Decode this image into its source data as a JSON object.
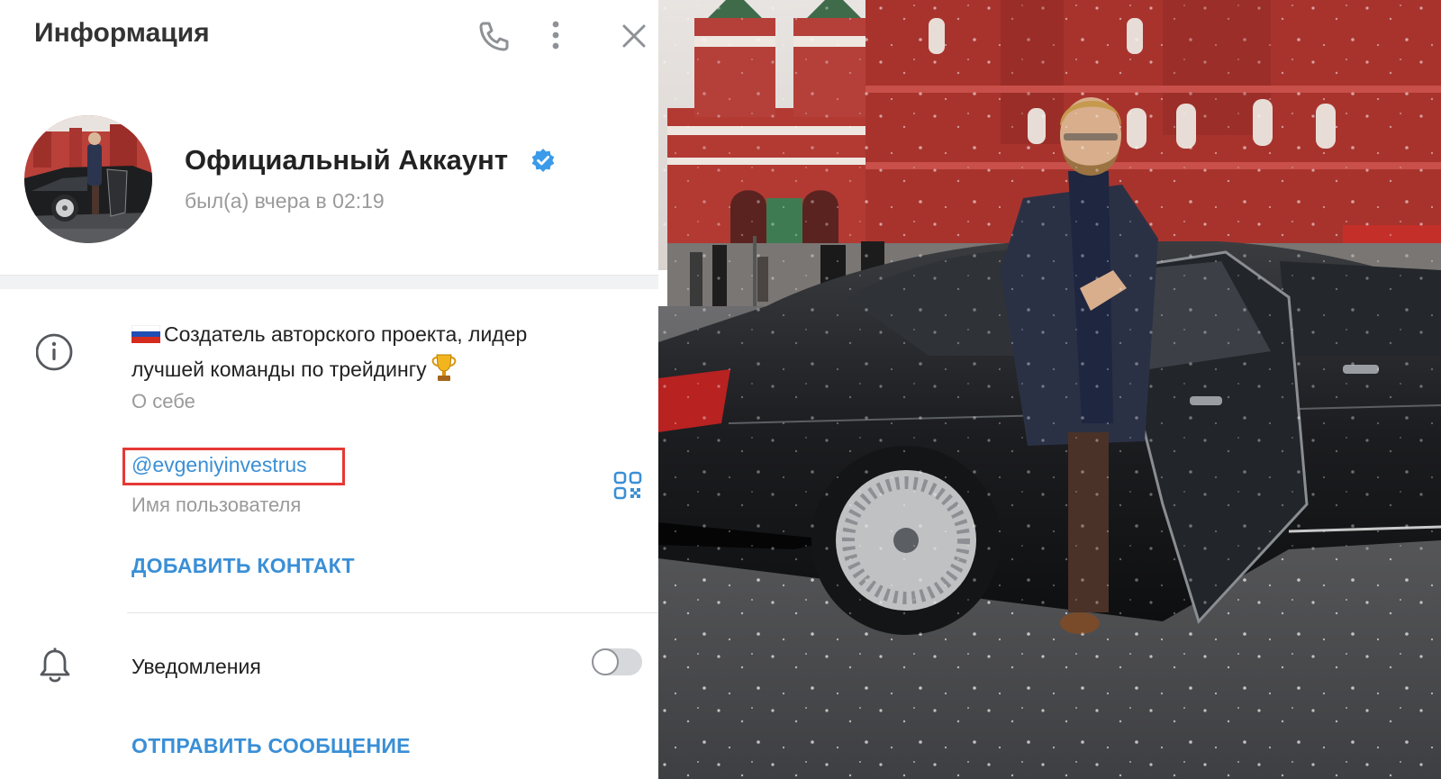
{
  "header": {
    "title": "Информация",
    "call_icon": "phone-icon",
    "more_icon": "more-vertical-icon",
    "close_icon": "close-icon"
  },
  "profile": {
    "name": "Официальный Аккаунт",
    "verified_icon": "verified-badge-icon",
    "status": "был(а) вчера в 02:19"
  },
  "bio": {
    "line1": "Создатель авторского проекта, лидер",
    "line2": "лучшей команды по трейдингу",
    "label": "О себе",
    "icon": "info-icon"
  },
  "username": {
    "value": "@evgeniyinvestrus",
    "label": "Имя пользователя",
    "qr_icon": "qr-code-icon"
  },
  "actions": {
    "add_contact": "ДОБАВИТЬ КОНТАКТ",
    "send_message": "ОТПРАВИТЬ СООБЩЕНИЕ"
  },
  "notifications": {
    "label": "Уведомления",
    "enabled": false,
    "icon": "bell-icon"
  },
  "colors": {
    "accent": "#3a8fd6",
    "highlight_box": "#e53935",
    "verified": "#3a9bea"
  }
}
